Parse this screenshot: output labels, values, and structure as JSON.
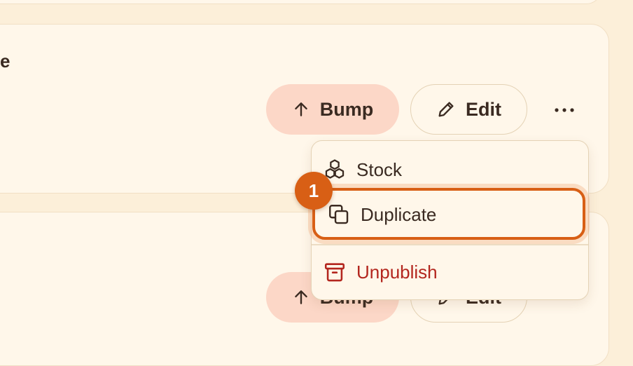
{
  "listing": {
    "title_fragment": "e",
    "bump_label": "Bump",
    "edit_label": "Edit"
  },
  "listing_second": {
    "bump_label": "Bump",
    "edit_label": "Edit"
  },
  "menu": {
    "items": [
      {
        "label": "Stock",
        "icon": "cubes-icon"
      },
      {
        "label": "Duplicate",
        "icon": "copy-icon"
      },
      {
        "label": "Unpublish",
        "icon": "archive-icon"
      }
    ]
  },
  "annotation": {
    "step_number": "1"
  },
  "colors": {
    "background": "#fcefd9",
    "card": "#fff7ea",
    "bump_fill": "#fcd7c7",
    "text": "#3a2a21",
    "danger": "#b3261e",
    "highlight": "#d85f15"
  }
}
